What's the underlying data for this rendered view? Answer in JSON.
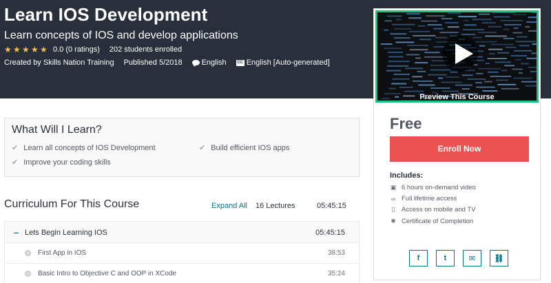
{
  "header": {
    "title": "Learn IOS Development",
    "subtitle": "Learn concepts of IOS and develop applications",
    "rating_value": "0.0 (0 ratings)",
    "enrolled": "202 students enrolled",
    "created_by": "Created by Skills Nation Training",
    "published": "Published 5/2018",
    "language": "English",
    "captions": "English [Auto-generated]",
    "stars_filled": 5,
    "stars_total": 5,
    "star_color": "#f4c150",
    "background": "#29303b"
  },
  "sidebar": {
    "preview_label": "Preview This Course",
    "price": "Free",
    "enroll_label": "Enroll Now",
    "enroll_color": "#ec5252",
    "includes_heading": "Includes:",
    "includes": [
      {
        "icon": "video-icon",
        "text": "6 hours on-demand video"
      },
      {
        "icon": "infinity-icon",
        "text": "Full lifetime access"
      },
      {
        "icon": "mobile-icon",
        "text": "Access on mobile and TV"
      },
      {
        "icon": "certificate-icon",
        "text": "Certificate of Completion"
      }
    ],
    "share": [
      {
        "icon": "facebook-icon",
        "glyph": "f"
      },
      {
        "icon": "twitter-icon",
        "glyph": "t"
      },
      {
        "icon": "email-icon",
        "glyph": "✉"
      },
      {
        "icon": "link-icon",
        "glyph": "⛓"
      }
    ]
  },
  "learn": {
    "heading": "What Will I Learn?",
    "items": [
      "Learn all concepts of IOS Development",
      "Build efficient IOS apps",
      "Improve your coding skills"
    ]
  },
  "curriculum": {
    "heading": "Curriculum For This Course",
    "expand_all": "Expand All",
    "lectures_count": "16 Lectures",
    "total_time": "05:45:15",
    "section": {
      "title": "Lets Begin Learning IOS",
      "time": "05:45:15"
    },
    "lectures": [
      {
        "title": "First App in IOS",
        "time": "38:53"
      },
      {
        "title": "Basic Intro to Objective C and OOP in XCode",
        "time": "35:24"
      }
    ]
  }
}
